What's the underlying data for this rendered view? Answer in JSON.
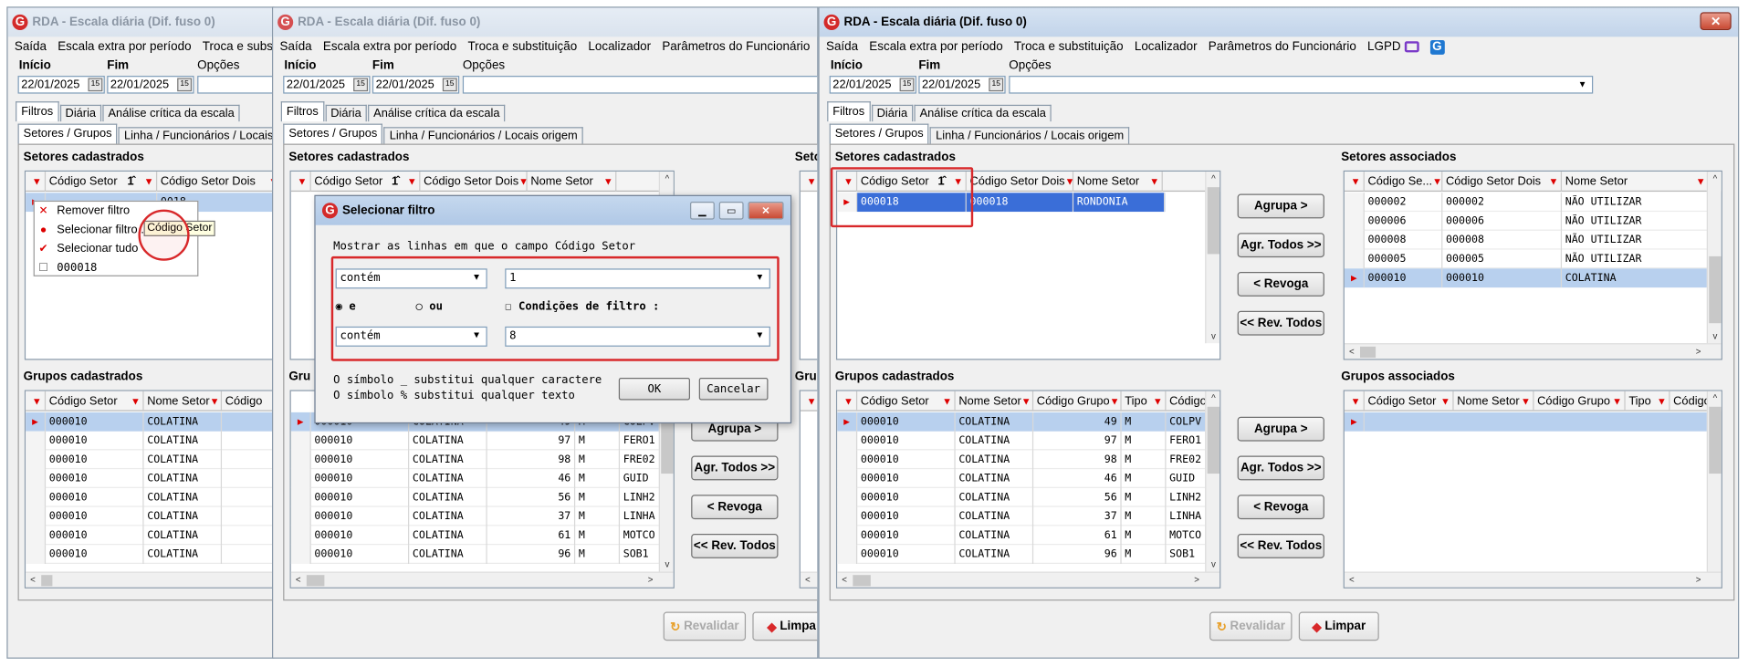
{
  "window": {
    "title": "RDA - Escala diária (Dif. fuso 0)",
    "close_glyph": "✕"
  },
  "menu": {
    "saida": "Saída",
    "escala_extra": "Escala extra por período",
    "troca": "Troca e substituição",
    "troca_truncated": "Troca e substituiç",
    "localizador": "Localizador",
    "parametros": "Parâmetros do Funcionário",
    "lgpd": "LGPD"
  },
  "filters": {
    "inicio_label": "Início",
    "fim_label": "Fim",
    "opcoes_label": "Opções",
    "inicio_value": "22/01/2025",
    "fim_value": "22/01/2025",
    "cal_glyph": "15"
  },
  "tabs": {
    "filtros": "Filtros",
    "diaria": "Diária",
    "analise": "Análise crítica da escala",
    "setores_grupos": "Setores / Grupos",
    "linha_funcionarios": "Linha / Funcionários / Locais origem",
    "linha_funcionarios_truncated": "Linha / Funcionários / Locais orig"
  },
  "sections": {
    "setores_cadastrados": "Setores cadastrados",
    "setores_associados": "Setores associados",
    "grupos_cadastrados": "Grupos cadastrados",
    "grupos_associados": "Grupos associados",
    "seto_truncated": "Seto",
    "gru_truncated": "Gru",
    "gru_truncated2": "Gru"
  },
  "headers": {
    "codigo_setor": "Código Setor",
    "codigo_setor_dois": "Código Setor Dois",
    "nome_setor": "Nome Setor",
    "codigo_grupo": "Código Grupo",
    "tipo": "Tipo",
    "codigo": "Código",
    "codigo_se": "Código Se...",
    "codigo_trunc": "Código",
    "sort_glyph": "1̂",
    "filter_glyph": "▼",
    "filter_active_glyph": "⯆"
  },
  "setores_cadastrados_row": {
    "codigo": "000018",
    "codigo_dois": "000018",
    "nome": "RONDONIA"
  },
  "setores_associados_rows": [
    {
      "codigo": "000002",
      "codigo_dois": "000002",
      "nome": "NÃO UTILIZAR"
    },
    {
      "codigo": "000006",
      "codigo_dois": "000006",
      "nome": "NÃO UTILIZAR"
    },
    {
      "codigo": "000008",
      "codigo_dois": "000008",
      "nome": "NÃO UTILIZAR"
    },
    {
      "codigo": "000005",
      "codigo_dois": "000005",
      "nome": "NÃO UTILIZAR"
    },
    {
      "codigo": "000010",
      "codigo_dois": "000010",
      "nome": "COLATINA"
    }
  ],
  "grupos_rows": [
    {
      "setor": "000010",
      "nome": "COLATINA",
      "grupo": "49",
      "tipo": "M",
      "codigo": "COLPV"
    },
    {
      "setor": "000010",
      "nome": "COLATINA",
      "grupo": "97",
      "tipo": "M",
      "codigo": "FERO1"
    },
    {
      "setor": "000010",
      "nome": "COLATINA",
      "grupo": "98",
      "tipo": "M",
      "codigo": "FRE02"
    },
    {
      "setor": "000010",
      "nome": "COLATINA",
      "grupo": "46",
      "tipo": "M",
      "codigo": "GUID"
    },
    {
      "setor": "000010",
      "nome": "COLATINA",
      "grupo": "56",
      "tipo": "M",
      "codigo": "LINH2"
    },
    {
      "setor": "000010",
      "nome": "COLATINA",
      "grupo": "37",
      "tipo": "M",
      "codigo": "LINHA"
    },
    {
      "setor": "000010",
      "nome": "COLATINA",
      "grupo": "61",
      "tipo": "M",
      "codigo": "MOTCO"
    },
    {
      "setor": "000010",
      "nome": "COLATINA",
      "grupo": "96",
      "tipo": "M",
      "codigo": "SOB1"
    }
  ],
  "context_menu": {
    "remover": "Remover filtro",
    "selecionar_filtro": "Selecionar filtro...",
    "selecionar_tudo": "Selecionar tudo",
    "item_000018": "000018",
    "cell_partial": "0018",
    "tooltip": "Código Setor"
  },
  "dialog": {
    "title": "Selecionar filtro",
    "prompt": "Mostrar as linhas em que o campo Código Setor",
    "cond1_op": "contém",
    "cond1_value": "1",
    "radio_e": "e",
    "radio_ou": "ou",
    "condicoes": "Condições de filtro :",
    "cond2_op": "contém",
    "cond2_value": "8",
    "hint1": "O símbolo _ substitui qualquer caractere",
    "hint2": "O símbolo % substitui qualquer texto",
    "ok": "OK",
    "cancelar": "Cancelar"
  },
  "buttons": {
    "agrupa": "Agrupa >",
    "agr_todos": "Agr. Todos >>",
    "revoga": "< Revoga",
    "rev_todos": "<< Rev. Todos",
    "revalidar": "Revalidar",
    "limpar": "Limpar",
    "limpar_truncated": "Limpa"
  },
  "colors": {
    "highlight": "#d8282a",
    "selection": "#3a6ed8",
    "selection_light": "#b8d0ee"
  }
}
